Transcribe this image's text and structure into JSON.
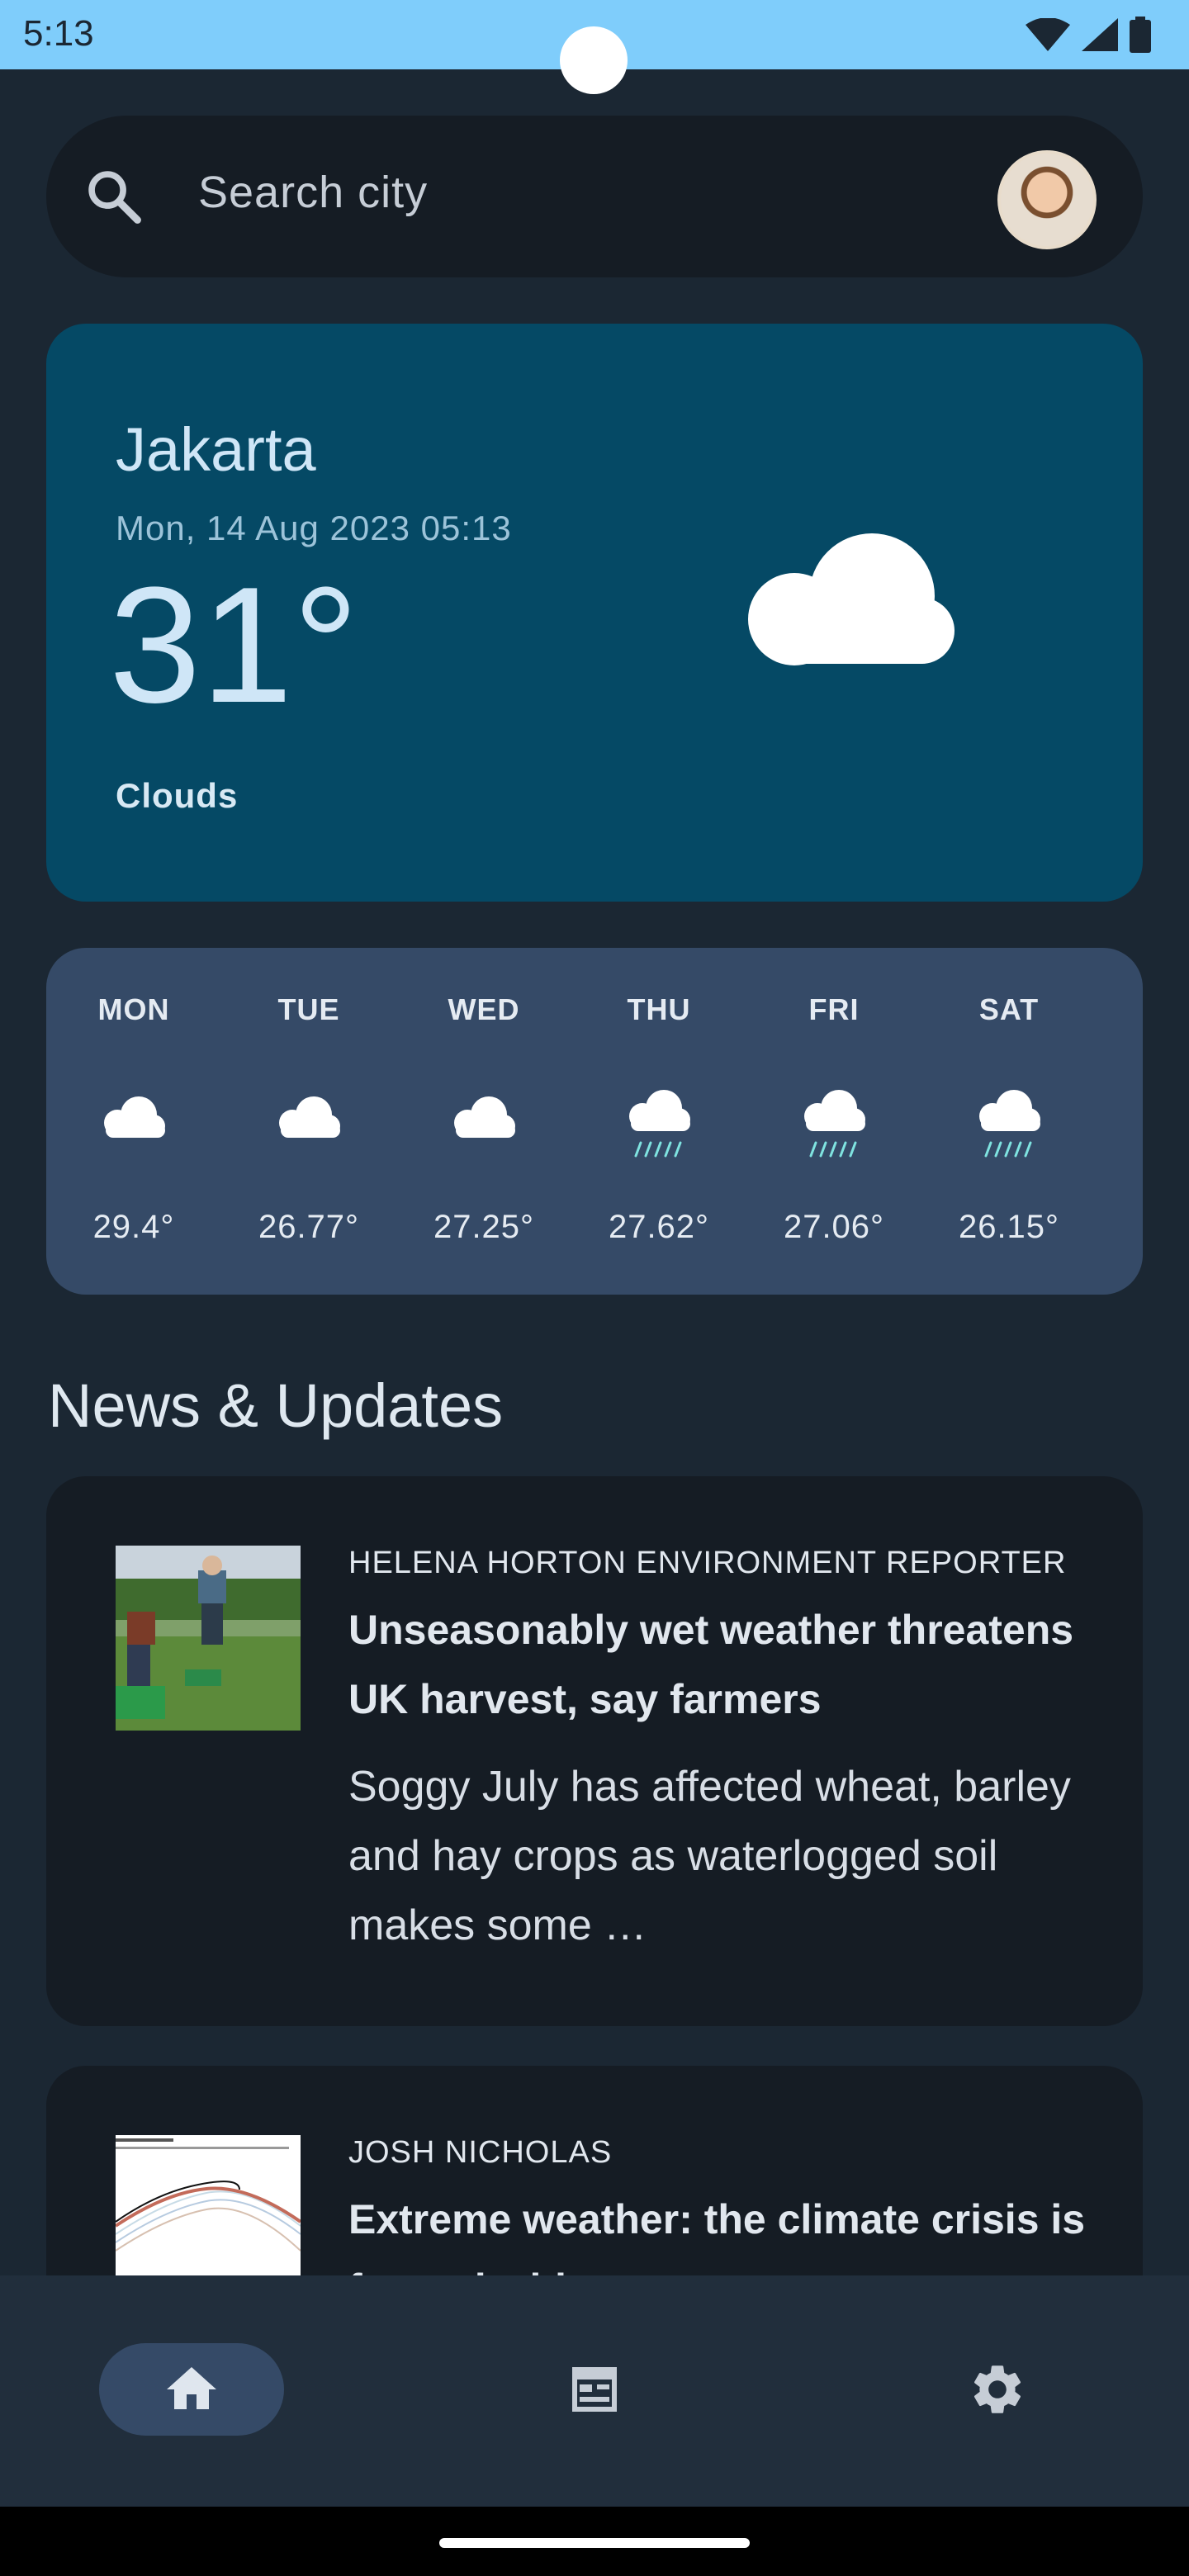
{
  "status_bar": {
    "time": "5:13"
  },
  "search": {
    "placeholder": "Search city"
  },
  "current": {
    "city": "Jakarta",
    "date": "Mon, 14 Aug 2023 05:13",
    "temperature": "31°",
    "condition": "Clouds",
    "icon": "cloud-icon"
  },
  "forecast": [
    {
      "day": "MON",
      "temp": "29.4°",
      "icon": "cloud-icon"
    },
    {
      "day": "TUE",
      "temp": "26.77°",
      "icon": "cloud-icon"
    },
    {
      "day": "WED",
      "temp": "27.25°",
      "icon": "cloud-icon"
    },
    {
      "day": "THU",
      "temp": "27.62°",
      "icon": "rain-cloud-icon"
    },
    {
      "day": "FRI",
      "temp": "27.06°",
      "icon": "rain-cloud-icon"
    },
    {
      "day": "SAT",
      "temp": "26.15°",
      "icon": "rain-cloud-icon"
    }
  ],
  "news_section": {
    "title": "News & Updates"
  },
  "news": [
    {
      "author": "HELENA HORTON ENVIRONMENT REPORTER",
      "headline": "Unseasonably wet weather threatens UK harvest, say farmers",
      "summary": "Soggy July has affected wheat, barley and hay crops as waterlogged soil makes some …"
    },
    {
      "author": "JOSH NICHOLAS",
      "headline": "Extreme weather: the climate crisis is far and wide"
    }
  ],
  "bottom_nav": [
    {
      "name": "home",
      "icon": "home-icon",
      "active": true
    },
    {
      "name": "news",
      "icon": "newspaper-icon",
      "active": false
    },
    {
      "name": "settings",
      "icon": "gear-icon",
      "active": false
    }
  ],
  "colors": {
    "background": "#1b2733",
    "current_card": "#054965",
    "forecast_card": "#354a67",
    "news_card": "#151c24",
    "status_bar": "#7fcdfb",
    "rain": "#7fe3e0"
  }
}
